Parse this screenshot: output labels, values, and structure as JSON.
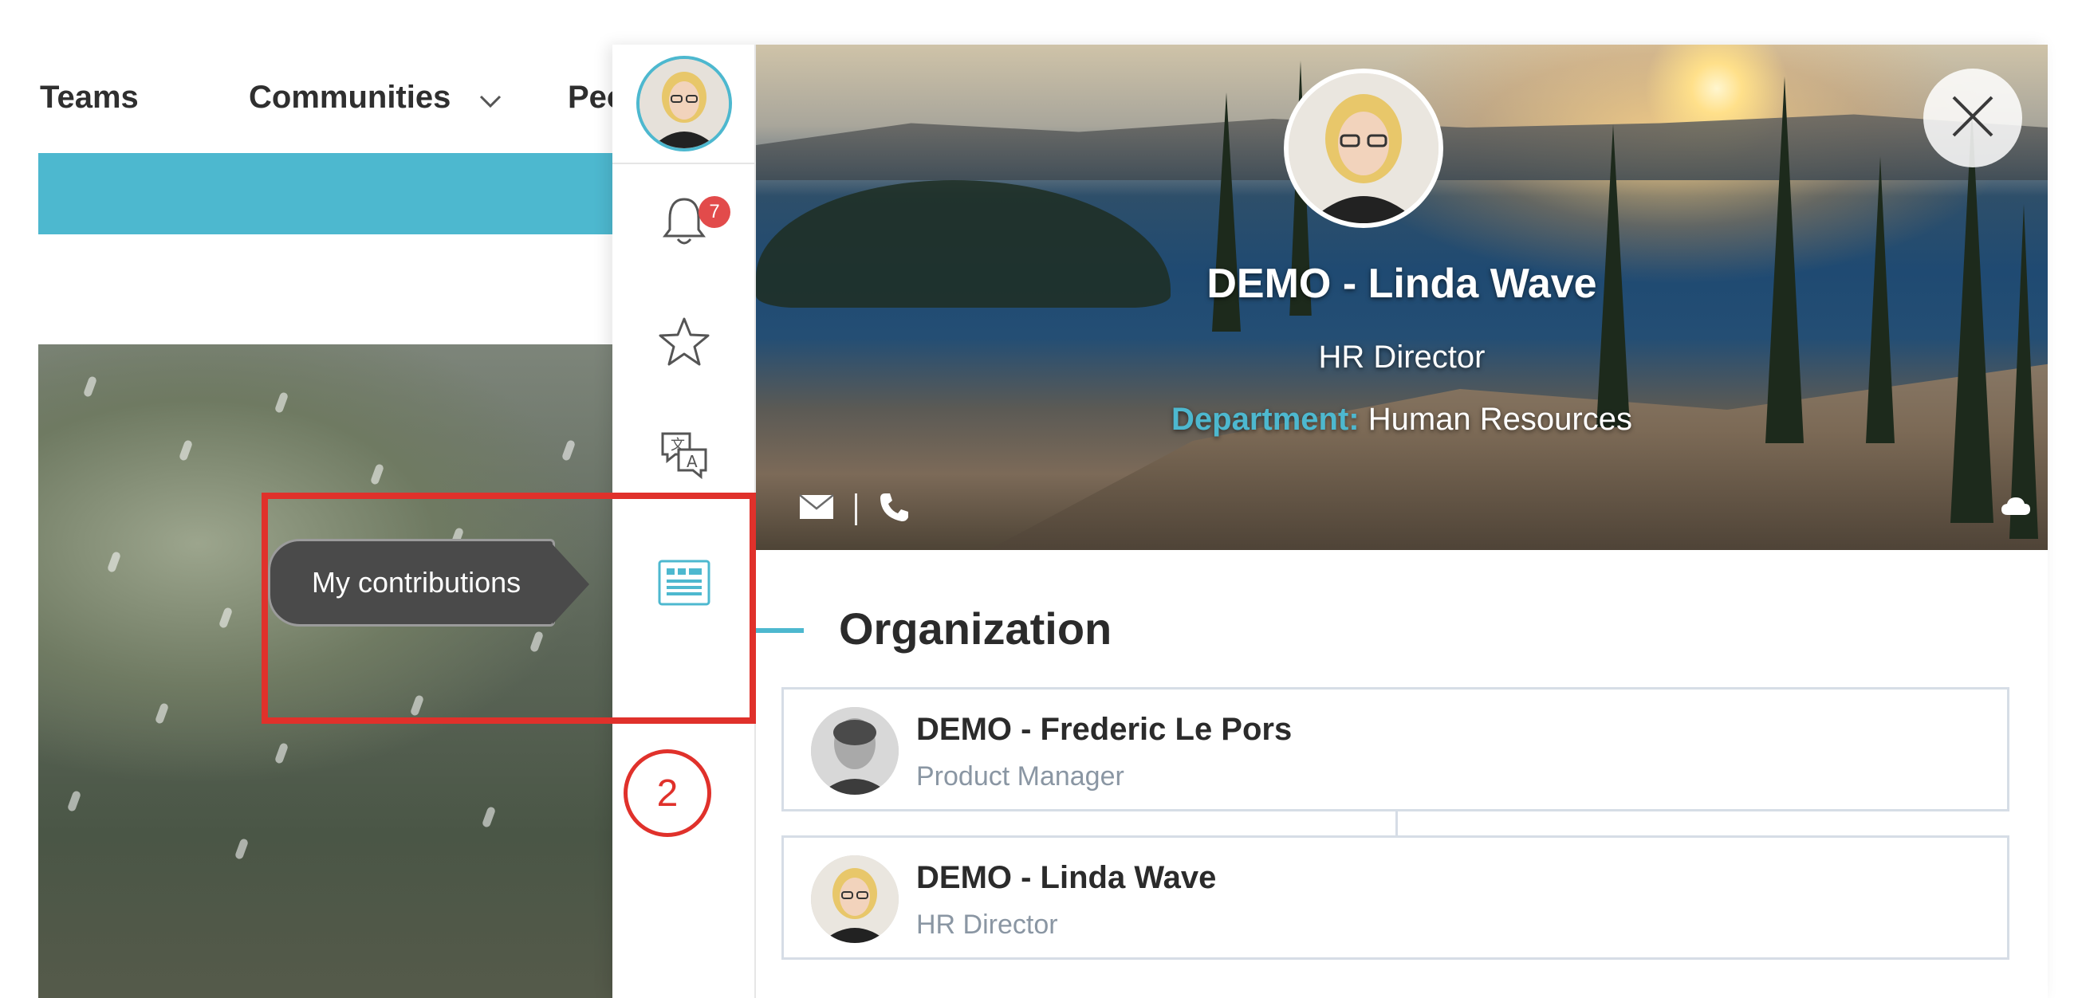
{
  "nav": {
    "teams": "Teams",
    "communities": "Communities",
    "people": "Peo"
  },
  "rail": {
    "notifications_count": "7",
    "icons": [
      "avatar",
      "bell-icon",
      "star-icon",
      "translate-icon",
      "contributions-icon"
    ]
  },
  "profile": {
    "name": "DEMO - Linda Wave",
    "title": "HR Director",
    "department_label": "Department:",
    "department_value": "Human Resources"
  },
  "organization": {
    "heading": "Organization",
    "members": [
      {
        "name": "DEMO - Frederic Le Pors",
        "role": "Product Manager"
      },
      {
        "name": "DEMO - Linda Wave",
        "role": "HR Director"
      }
    ]
  },
  "annotations": {
    "tooltip": "My contributions",
    "step": "2"
  },
  "colors": {
    "accent": "#4db8cf",
    "badge": "#e24b4b",
    "annotation": "#e0312b"
  }
}
